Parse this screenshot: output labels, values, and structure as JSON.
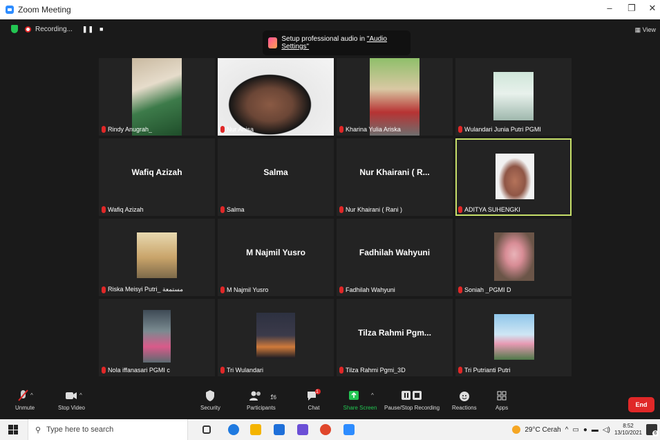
{
  "window": {
    "title": "Zoom Meeting",
    "minimize": "–",
    "restore": "❐",
    "close": "✕"
  },
  "topbar": {
    "recording_label": "Recording...",
    "pause": "❚❚",
    "stop": "■",
    "view_label": "View"
  },
  "notice": {
    "text_prefix": "Setup professional audio in ",
    "link_text": "\"Audio Settings\""
  },
  "participants": [
    {
      "label": "Rindy Anugrah_",
      "display": "",
      "video": "photo-class",
      "active": false
    },
    {
      "label": "Nur Anisa",
      "display": "",
      "video": "face",
      "active": false
    },
    {
      "label": "Kharina Yulia Ariska",
      "display": "",
      "video": "photo-room",
      "active": false
    },
    {
      "label": "Wulandari Junia Putri PGMI",
      "display": "",
      "video": "photo-portrait",
      "active": false
    },
    {
      "label": "Wafiq Azizah",
      "display": "Wafiq Azizah",
      "video": "",
      "active": false
    },
    {
      "label": "Salma",
      "display": "Salma",
      "video": "",
      "active": false
    },
    {
      "label": "Nur Khairani ( Rani )",
      "display": "Nur Khairani ( R...",
      "video": "",
      "active": false
    },
    {
      "label": "ADITYA SUHENGKI",
      "display": "",
      "video": "photo-man",
      "active": true
    },
    {
      "label": "Riska Meisyi Putri_ مستمعة",
      "display": "",
      "video": "photo-building",
      "active": false
    },
    {
      "label": "M Najmil Yusro",
      "display": "M Najmil Yusro",
      "video": "",
      "active": false
    },
    {
      "label": "Fadhilah Wahyuni",
      "display": "Fadhilah Wahyuni",
      "video": "",
      "active": false
    },
    {
      "label": "Soniah _PGMI D",
      "display": "",
      "video": "photo-hijab",
      "active": false
    },
    {
      "label": "Nola iffanasari PGMI c",
      "display": "",
      "video": "photo-street",
      "active": false
    },
    {
      "label": "Tri Wulandari",
      "display": "",
      "video": "photo-moon",
      "active": false
    },
    {
      "label": "Tilza Rahmi Pgmi_3D",
      "display": "Tilza Rahmi Pgm...",
      "video": "",
      "active": false
    },
    {
      "label": "Tri Putrianti Putri",
      "display": "",
      "video": "photo-sky",
      "active": false
    }
  ],
  "toolbar": {
    "unmute": "Unmute",
    "stop_video": "Stop Video",
    "security": "Security",
    "participants": "Participants",
    "participants_count": "16",
    "chat": "Chat",
    "chat_badge": "1",
    "share_screen": "Share Screen",
    "pause_recording": "Pause/Stop Recording",
    "reactions": "Reactions",
    "apps": "Apps",
    "end": "End"
  },
  "taskbar": {
    "search_placeholder": "Type here to search",
    "weather": "29°C  Cerah",
    "time": "8:52",
    "date": "13/10/2021",
    "notifications": "6"
  },
  "colors": {
    "active_speaker": "#c7e06a",
    "end": "#e02828",
    "share": "#23c552",
    "accent": "#2d8cff"
  }
}
